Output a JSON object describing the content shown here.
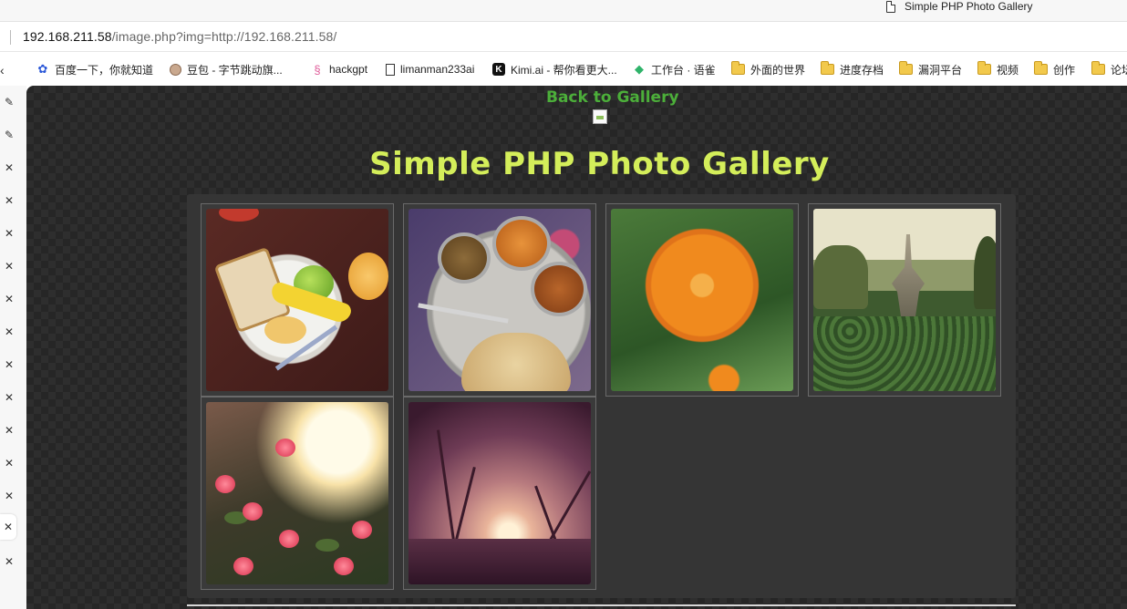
{
  "tab": {
    "title": "Simple PHP Photo Gallery",
    "icon": "document-icon"
  },
  "address_bar": {
    "host": "192.168.211.58",
    "path": "/image.php?img=http://192.168.211.58/"
  },
  "bookmarks": [
    {
      "label": "百度一下，你就知道",
      "icon": "baidu-paw-icon"
    },
    {
      "label": "豆包 - 字节跳动旗...",
      "icon": "doubao-avatar-icon"
    },
    {
      "label": "hackgpt",
      "icon": "seahorse-icon"
    },
    {
      "label": "limanman233ai",
      "icon": "document-icon"
    },
    {
      "label": "Kimi.ai - 帮你看更大...",
      "icon": "kimi-icon"
    },
    {
      "label": "工作台 · 语雀",
      "icon": "yuque-bird-icon"
    },
    {
      "label": "外面的世界",
      "icon": "folder-icon"
    },
    {
      "label": "进度存档",
      "icon": "folder-icon"
    },
    {
      "label": "漏洞平台",
      "icon": "folder-icon"
    },
    {
      "label": "视频",
      "icon": "folder-icon"
    },
    {
      "label": "创作",
      "icon": "folder-icon"
    },
    {
      "label": "论坛",
      "icon": "folder-icon"
    }
  ],
  "page": {
    "back_link": "Back to Gallery",
    "title": "Simple PHP Photo Gallery",
    "accent_green": "#4caf3a",
    "title_color": "#d4ee5a",
    "photos": [
      {
        "subject": "breakfast plate"
      },
      {
        "subject": "thali meal"
      },
      {
        "subject": "orange flower"
      },
      {
        "subject": "garden fountain"
      },
      {
        "subject": "roses at sunset"
      },
      {
        "subject": "sunset silhouette"
      }
    ]
  },
  "side_panel": {
    "icons": [
      "pencil-icon",
      "pencil-icon",
      "close-icon",
      "close-icon",
      "close-icon",
      "close-icon",
      "close-icon",
      "close-icon",
      "close-icon",
      "close-icon",
      "close-icon",
      "close-icon",
      "close-icon",
      "close-icon"
    ]
  }
}
